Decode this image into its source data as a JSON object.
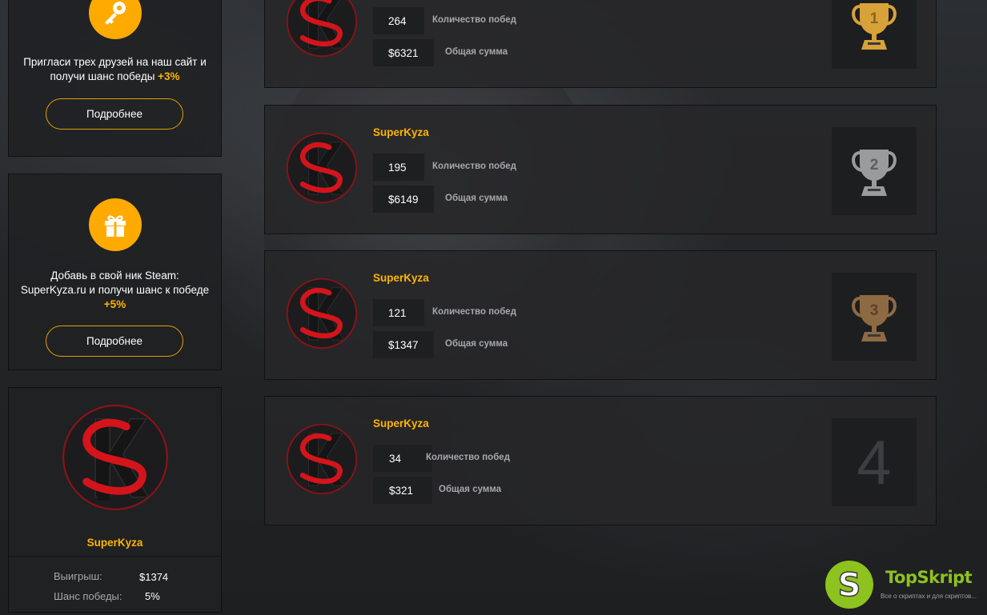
{
  "promos": [
    {
      "text": "Пригласи трех друзей на наш сайт и получи шанс победы ",
      "bonus": "+3%",
      "button": "Подробнее",
      "icon": "key-icon"
    },
    {
      "text": "Добавь в свой ник Steam: SuperKyza.ru и получи шанс к победе ",
      "bonus": "+5%",
      "button": "Подробнее",
      "icon": "gift-icon"
    }
  ],
  "profile": {
    "username": "SuperKyza",
    "win_label": "Выигрыш:",
    "win_value": "$1374",
    "chance_label": "Шанс победы:",
    "chance_value": "5%"
  },
  "leaderboard": [
    {
      "rank": 1,
      "username": "",
      "wins": "264",
      "wins_label": "Количество побед",
      "sum": "$6321",
      "sum_label": "Общая сумма",
      "trophy": "gold-trophy-icon"
    },
    {
      "rank": 2,
      "username": "SuperKyza",
      "wins": "195",
      "wins_label": "Количество побед",
      "sum": "$6149",
      "sum_label": "Общая сумма",
      "trophy": "silver-trophy-icon"
    },
    {
      "rank": 3,
      "username": "SuperKyza",
      "wins": "121",
      "wins_label": "Количество побед",
      "sum": "$1347",
      "sum_label": "Общая сумма",
      "trophy": "bronze-trophy-icon"
    },
    {
      "rank": 4,
      "username": "SuperKyza",
      "wins": "34",
      "wins_label": "Количество побед",
      "sum": "$321",
      "sum_label": "Общая сумма",
      "rank_text": "4"
    }
  ],
  "colors": {
    "accent": "#ffb400",
    "gold": "#d7a238",
    "silver": "#9a9b9d",
    "bronze": "#8e6a43",
    "logo_red": "#d4141b"
  },
  "watermark": {
    "brand": "TopSkript",
    "tagline": "Все о скриптах и для скриптов...",
    "letter": "S"
  }
}
